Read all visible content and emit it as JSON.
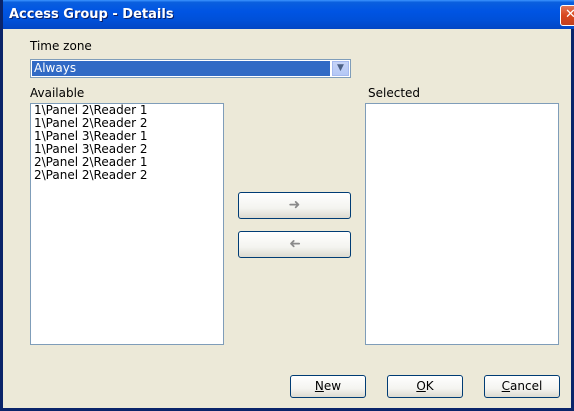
{
  "window": {
    "title": "Access Group - Details",
    "close_glyph": "✕"
  },
  "time_zone": {
    "label": "Time zone",
    "selected": "Always",
    "dropdown_icon": "chevron-down-icon"
  },
  "available": {
    "label": "Available",
    "items": [
      "1\\Panel 2\\Reader 1",
      "1\\Panel 2\\Reader 2",
      "1\\Panel 3\\Reader 1",
      "1\\Panel 3\\Reader 2",
      "2\\Panel 2\\Reader 1",
      "2\\Panel 2\\Reader 2"
    ]
  },
  "selected": {
    "label": "Selected",
    "items": []
  },
  "transfer": {
    "add_icon": "arrow-right-icon",
    "remove_icon": "arrow-left-icon"
  },
  "buttons": {
    "new": {
      "accel": "N",
      "rest": "ew"
    },
    "ok": {
      "accel": "O",
      "rest": "K"
    },
    "cancel": {
      "accel": "C",
      "rest": "ancel"
    }
  }
}
